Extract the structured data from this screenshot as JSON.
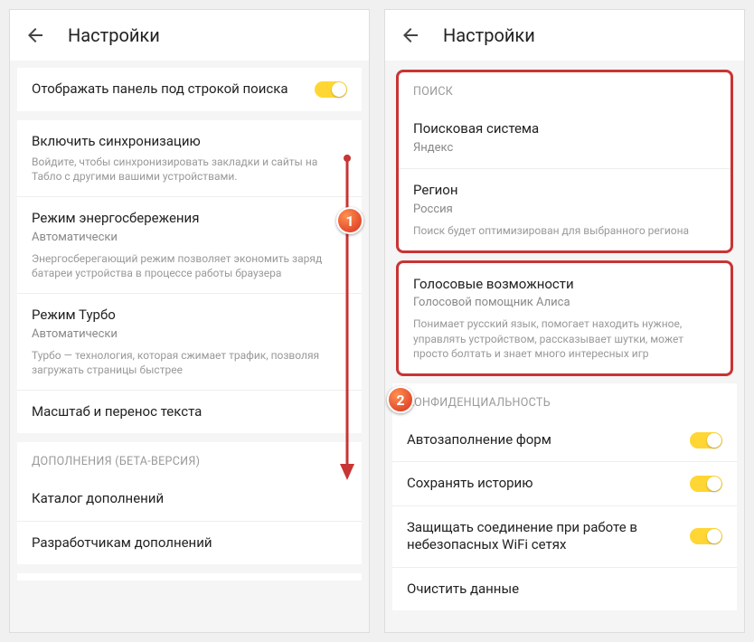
{
  "left": {
    "header_title": "Настройки",
    "display_panel": "Отображать панель под строкой поиска",
    "sync_title": "Включить синхронизацию",
    "sync_desc": "Войдите, чтобы синхронизировать закладки и сайты на Табло с другими вашими устройствами.",
    "energy_title": "Режим энергосбережения",
    "energy_sub": "Автоматически",
    "energy_desc": "Энергосберегающий режим позволяет экономить заряд батареи устройства в процессе работы браузера",
    "turbo_title": "Режим Турбо",
    "turbo_sub": "Автоматически",
    "turbo_desc": "Турбо — технология, которая сжимает трафик, позволяя загружать страницы быстрее",
    "scale_title": "Масштаб и перенос текста",
    "addons_header": "ДОПОЛНЕНИЯ (БЕТА-ВЕРСИЯ)",
    "addons_catalog": "Каталог дополнений",
    "addons_dev": "Разработчикам дополнений"
  },
  "right": {
    "header_title": "Настройки",
    "search_header": "ПОИСК",
    "search_engine_title": "Поисковая система",
    "search_engine_sub": "Яндекс",
    "region_title": "Регион",
    "region_sub": "Россия",
    "region_desc": "Поиск будет оптимизирован для выбранного региона",
    "voice_title": "Голосовые возможности",
    "voice_sub": "Голосовой помощник Алиса",
    "voice_desc": "Понимает русский язык, помогает находить нужное, управлять устройством, рассказывает шутки, может просто болтать и знает много интересных игр",
    "privacy_header": "КОНФИДЕНЦИАЛЬНОСТЬ",
    "autofill": "Автозаполнение форм",
    "history": "Сохранять историю",
    "wifi_protect": "Защищать соединение при работе в небезопасных WiFi сетях",
    "clear_data": "Очистить данные"
  },
  "badges": {
    "one": "1",
    "two": "2"
  }
}
